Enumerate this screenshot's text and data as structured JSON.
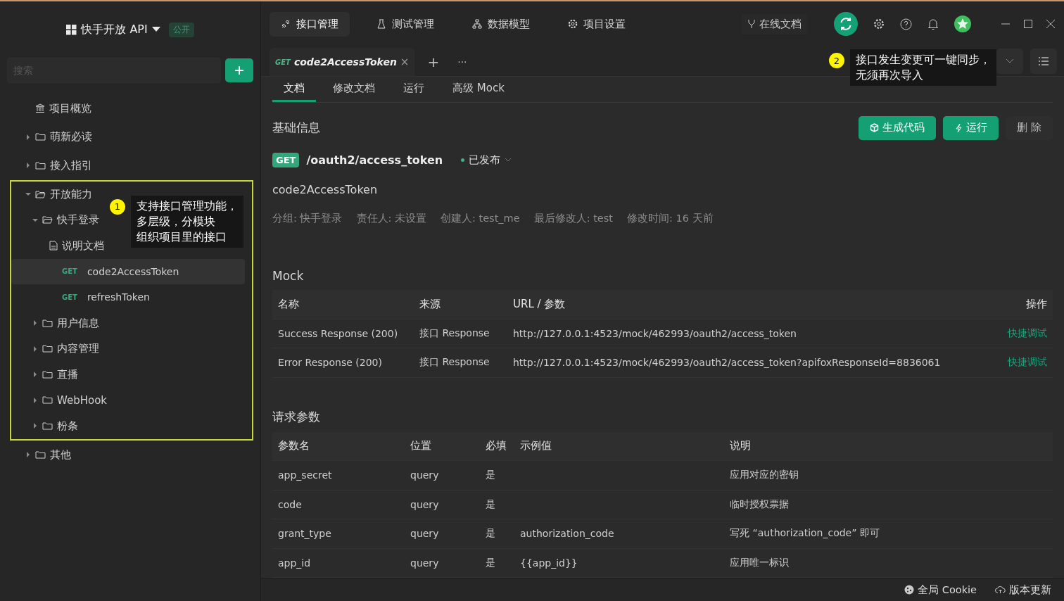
{
  "project": {
    "name": "快手开放 API",
    "badge": "公开"
  },
  "search": {
    "placeholder": "搜索"
  },
  "add_button": "+",
  "tree": [
    {
      "kind": "overview",
      "label": "项目概览",
      "selected": false,
      "highlighted": false
    },
    {
      "kind": "folder",
      "label": "萌新必读",
      "expanded": false,
      "selected": false,
      "highlighted": false
    },
    {
      "kind": "folder",
      "label": "接入指引",
      "expanded": false,
      "selected": false,
      "highlighted": false
    },
    {
      "kind": "folder",
      "label": "开放能力",
      "expanded": true,
      "selected": false,
      "highlighted": true,
      "callout": {
        "number": "1",
        "lines": [
          "支持接口管理功能，",
          "多层级，分模块",
          "组织项目里的接口"
        ]
      },
      "children": [
        {
          "kind": "folder",
          "label": "快手登录",
          "expanded": true,
          "selected": false,
          "children": [
            {
              "kind": "doc",
              "label": "说明文档",
              "selected": false
            },
            {
              "kind": "api",
              "method": "GET",
              "label": "code2AccessToken",
              "selected": true
            },
            {
              "kind": "api",
              "method": "GET",
              "label": "refreshToken",
              "selected": false
            }
          ]
        },
        {
          "kind": "folder",
          "label": "用户信息",
          "expanded": false,
          "selected": false
        },
        {
          "kind": "folder",
          "label": "内容管理",
          "expanded": false,
          "selected": false
        },
        {
          "kind": "folder",
          "label": "直播",
          "expanded": false,
          "selected": false
        },
        {
          "kind": "folder",
          "label": "WebHook",
          "expanded": false,
          "selected": false
        },
        {
          "kind": "folder",
          "label": "粉条",
          "expanded": false,
          "selected": false
        }
      ]
    },
    {
      "kind": "folder",
      "label": "其他",
      "expanded": false,
      "selected": false,
      "highlighted": false
    }
  ],
  "top_tabs": [
    {
      "label": "接口管理",
      "selected": true
    },
    {
      "label": "测试管理",
      "selected": false
    },
    {
      "label": "数据模型",
      "selected": false
    },
    {
      "label": "项目设置",
      "selected": false
    }
  ],
  "online_docs": "在线文档",
  "sync_callout": {
    "number": "2",
    "lines": [
      "接口发生变更可一键同步，",
      "无须再次导入"
    ]
  },
  "doc_tabs": [
    {
      "method": "GET",
      "label": "code2AccessToken",
      "close": "×"
    }
  ],
  "tab_add": "+",
  "tab_more": "···",
  "sub_tabs": [
    {
      "label": "文档",
      "selected": true
    },
    {
      "label": "修改文档",
      "selected": false
    },
    {
      "label": "运行",
      "selected": false
    },
    {
      "label": "高级 Mock",
      "selected": false
    }
  ],
  "basic": {
    "heading": "基础信息",
    "buttons": [
      {
        "kind": "codegen",
        "label": "生成代码"
      },
      {
        "kind": "run",
        "label": "运行"
      },
      {
        "kind": "delete",
        "label": "删 除"
      }
    ],
    "method": "GET",
    "path": "/oauth2/access_token",
    "status": "已发布",
    "name": "code2AccessToken",
    "meta": [
      "分组: 快手登录",
      "责任人: 未设置",
      "创建人:  test_me",
      "最后修改人:  test",
      "修改时间: 16 天前"
    ]
  },
  "mock": {
    "heading": "Mock",
    "columns": [
      "名称",
      "来源",
      "URL / 参数",
      "操作"
    ],
    "rows": [
      {
        "name": "Success Response (200)",
        "source": "接口 Response",
        "url": "http://127.0.0.1:4523/mock/462993/oauth2/access_token",
        "action": "快捷调试"
      },
      {
        "name": "Error Response (200)",
        "source": "接口 Response",
        "url": "http://127.0.0.1:4523/mock/462993/oauth2/access_token?apifoxResponseId=8836061",
        "action": "快捷调试"
      }
    ]
  },
  "params": {
    "heading": "请求参数",
    "columns": [
      "参数名",
      "位置",
      "必填",
      "示例值",
      "说明"
    ],
    "rows": [
      [
        "app_secret",
        "query",
        "是",
        "",
        "应用对应的密钥"
      ],
      [
        "code",
        "query",
        "是",
        "",
        "临时授权票据"
      ],
      [
        "grant_type",
        "query",
        "是",
        "authorization_code",
        "写死 “authorization_code” 即可"
      ],
      [
        "app_id",
        "query",
        "是",
        "{{app_id}}",
        "应用唯一标识"
      ]
    ]
  },
  "status_bar": [
    {
      "kind": "cookie",
      "label": "全局 Cookie"
    },
    {
      "kind": "update",
      "label": "版本更新"
    }
  ]
}
